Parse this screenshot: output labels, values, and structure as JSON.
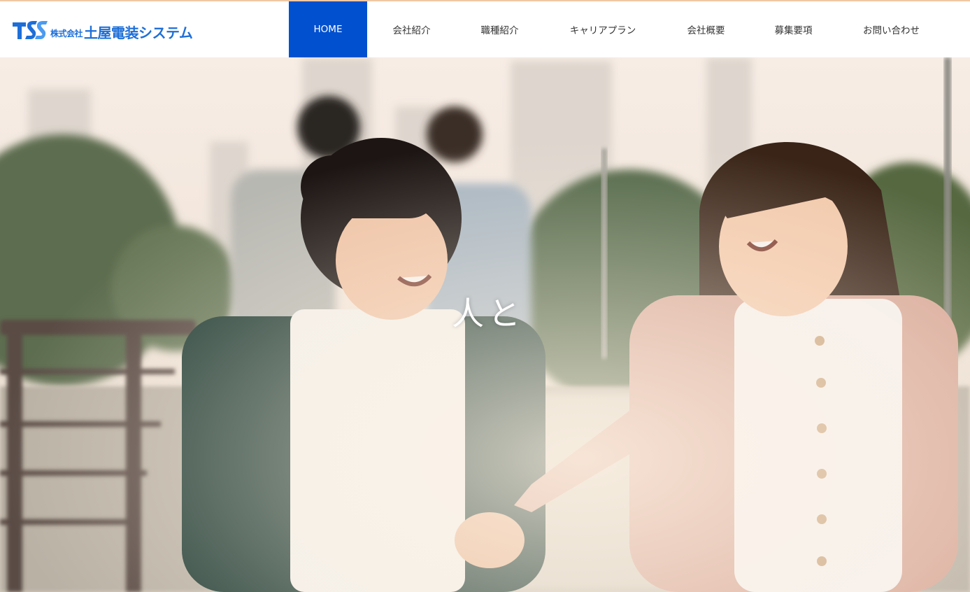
{
  "header": {
    "logo": {
      "mark_text": "TSS",
      "company_prefix": "株式会社",
      "company_name": "土屋電装システム"
    },
    "nav": [
      {
        "label": "HOME",
        "active": true
      },
      {
        "label": "会社紹介",
        "active": false
      },
      {
        "label": "職種紹介",
        "active": false
      },
      {
        "label": "キャリアプラン",
        "active": false
      },
      {
        "label": "会社概要",
        "active": false
      },
      {
        "label": "募集要項",
        "active": false
      },
      {
        "label": "お問い合わせ",
        "active": false
      }
    ]
  },
  "hero": {
    "caption": "人と"
  },
  "colors": {
    "brand_blue": "#1e6fd8",
    "nav_active": "#0050d0",
    "accent_line": "#f0c8a4"
  }
}
